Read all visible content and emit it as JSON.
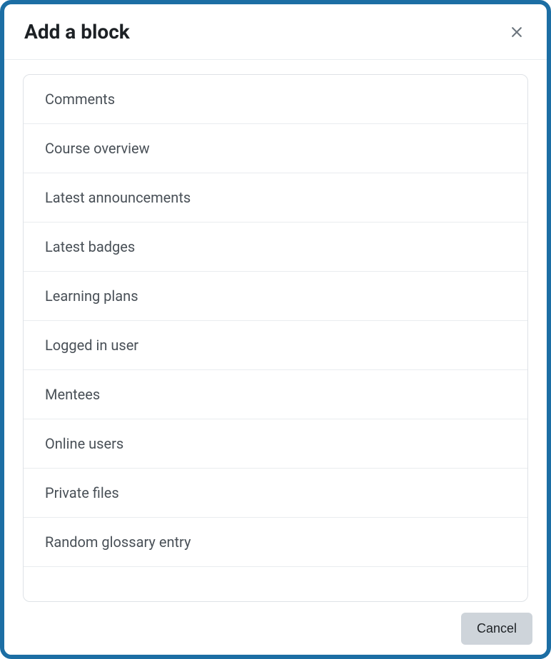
{
  "modal": {
    "title": "Add a block",
    "close_label": "Close"
  },
  "blocks": {
    "items": [
      {
        "label": "Comments"
      },
      {
        "label": "Course overview"
      },
      {
        "label": "Latest announcements"
      },
      {
        "label": "Latest badges"
      },
      {
        "label": "Learning plans"
      },
      {
        "label": "Logged in user"
      },
      {
        "label": "Mentees"
      },
      {
        "label": "Online users"
      },
      {
        "label": "Private files"
      },
      {
        "label": "Random glossary entry"
      }
    ]
  },
  "footer": {
    "cancel_label": "Cancel"
  }
}
